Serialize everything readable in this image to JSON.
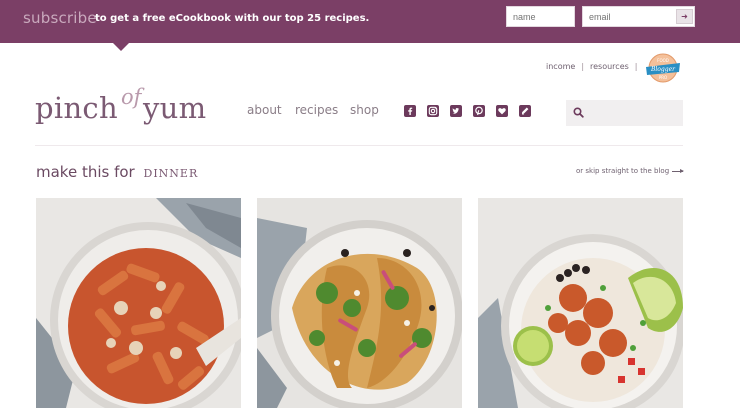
{
  "subscribe": {
    "label": "subscribe",
    "text": "to get a free eCookbook with our top 25 recipes.",
    "name_placeholder": "name",
    "email_placeholder": "email",
    "submit_glyph": "➜"
  },
  "utility_links": [
    {
      "label": "income"
    },
    {
      "label": "resources"
    }
  ],
  "badge": {
    "lines": [
      "FOOD",
      "Blogger",
      "PRO"
    ]
  },
  "logo": {
    "part1": "pinch",
    "part2": "of",
    "part3": "yum"
  },
  "nav": [
    {
      "label": "about"
    },
    {
      "label": "recipes"
    },
    {
      "label": "shop"
    }
  ],
  "social_icons": [
    "facebook-icon",
    "instagram-icon",
    "twitter-icon",
    "pinterest-icon",
    "bloglovin-icon",
    "feed-icon"
  ],
  "search": {
    "placeholder": ""
  },
  "section": {
    "prefix": "make this for",
    "meal": "DINNER",
    "skip_link": "or skip straight to the blog"
  },
  "cards": [
    {
      "image": "penne pasta in creamy tomato sauce"
    },
    {
      "image": "tacos with salsa verde"
    },
    {
      "image": "chicken burrito bowl with avocado and lime"
    }
  ],
  "colors": {
    "brand": "#7b3f66",
    "accent_light": "#c9a9bd",
    "text": "#6f6170"
  }
}
